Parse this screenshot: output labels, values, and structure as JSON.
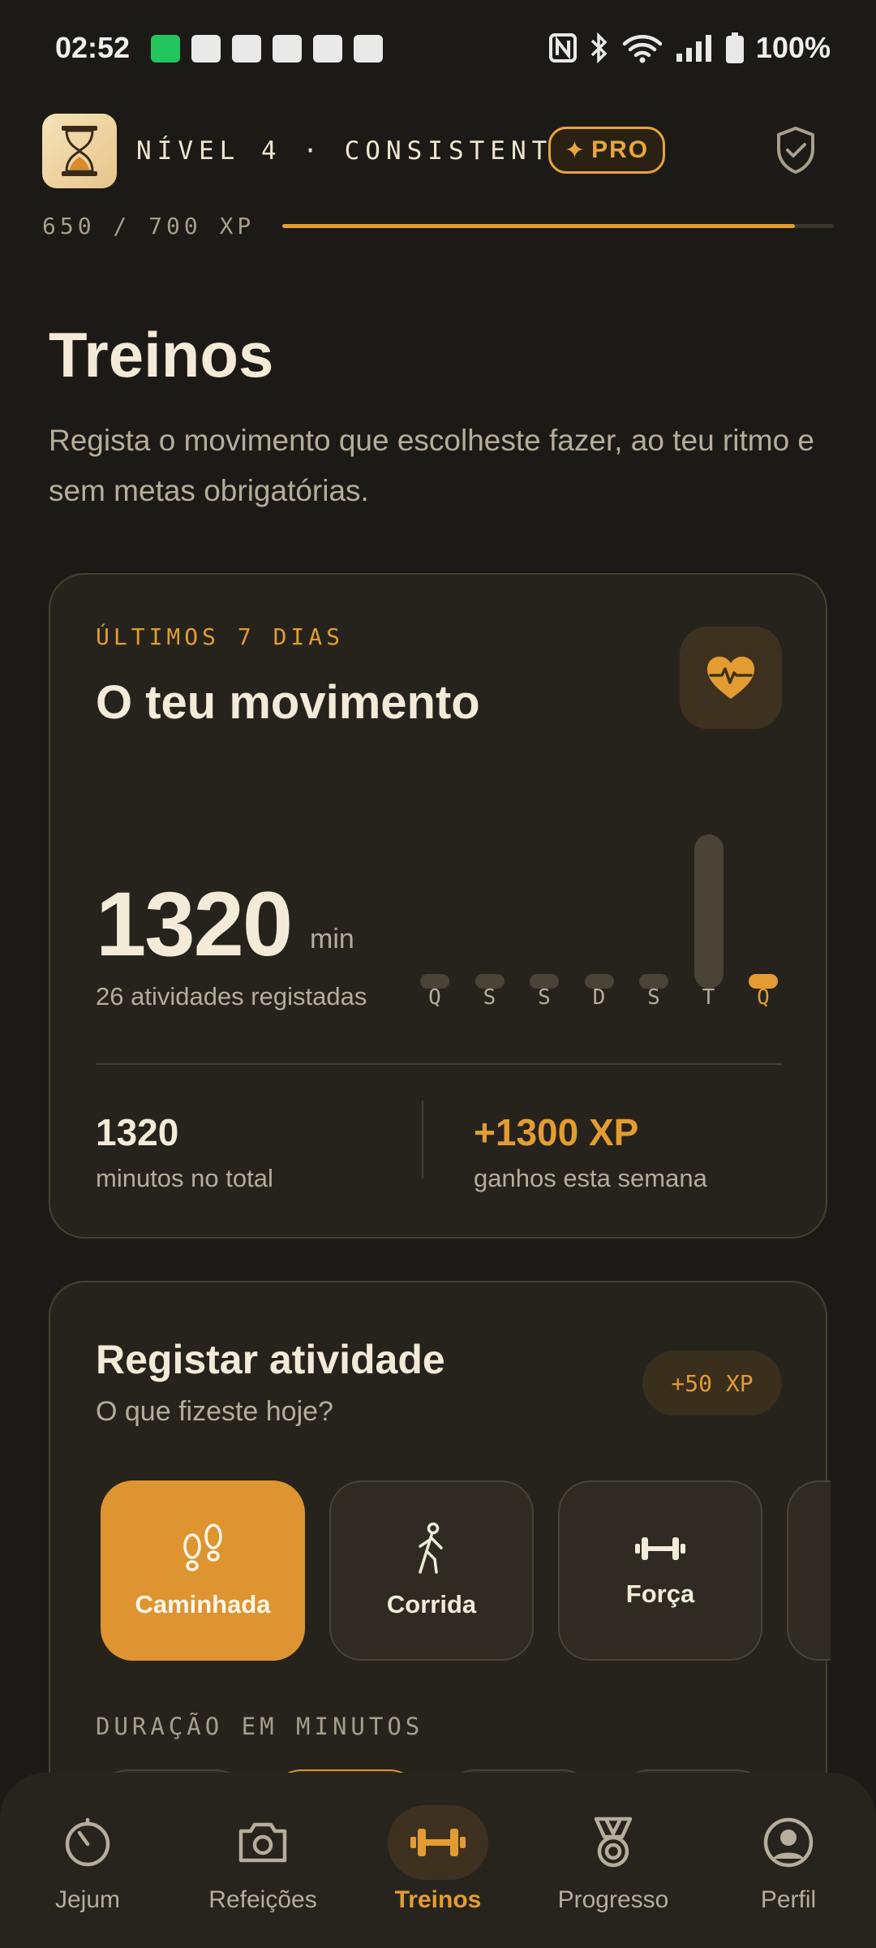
{
  "status_bar": {
    "time": "02:52",
    "battery": "100%"
  },
  "header": {
    "level_text": "NÍVEL 4 · CONSISTENTE",
    "pro_label": "PRO",
    "xp_text": "650 / 700 XP",
    "xp_progress": 0.93
  },
  "page": {
    "title": "Treinos",
    "subtitle": "Regista o movimento que escolheste fazer, ao teu ritmo e sem metas obrigatórias."
  },
  "movement_card": {
    "eyebrow": "ÚLTIMOS 7 DIAS",
    "title": "O teu movimento",
    "total": "1320",
    "unit": "min",
    "activities": "26 atividades registadas",
    "days": [
      "Q",
      "S",
      "S",
      "D",
      "S",
      "T",
      "Q"
    ],
    "day_minutes": [
      5,
      5,
      5,
      5,
      5,
      1300,
      5
    ],
    "today_index": 6,
    "stat_total_value": "1320",
    "stat_total_label": "minutos no total",
    "stat_xp_value": "+1300 XP",
    "stat_xp_label": "ganhos esta semana"
  },
  "register_card": {
    "title": "Registar atividade",
    "subtitle": "O que fizeste hoje?",
    "xp_reward": "+50 XP",
    "activities": [
      {
        "label": "Caminhada",
        "icon": "footprints-icon",
        "selected": true
      },
      {
        "label": "Corrida",
        "icon": "running-icon",
        "selected": false
      },
      {
        "label": "Força",
        "icon": "dumbbell-icon",
        "selected": false
      }
    ],
    "duration_label": "DURAÇÃO EM MINUTOS"
  },
  "nav": {
    "items": [
      {
        "label": "Jejum",
        "icon": "timer-icon"
      },
      {
        "label": "Refeições",
        "icon": "camera-icon"
      },
      {
        "label": "Treinos",
        "icon": "dumbbell-icon",
        "active": true
      },
      {
        "label": "Progresso",
        "icon": "medal-icon"
      },
      {
        "label": "Perfil",
        "icon": "profile-icon"
      }
    ]
  },
  "colors": {
    "background": "#1c1a16",
    "card": "#26231d",
    "accent": "#e39c32",
    "text": "#f3ead7",
    "muted": "#b6ad9a"
  }
}
